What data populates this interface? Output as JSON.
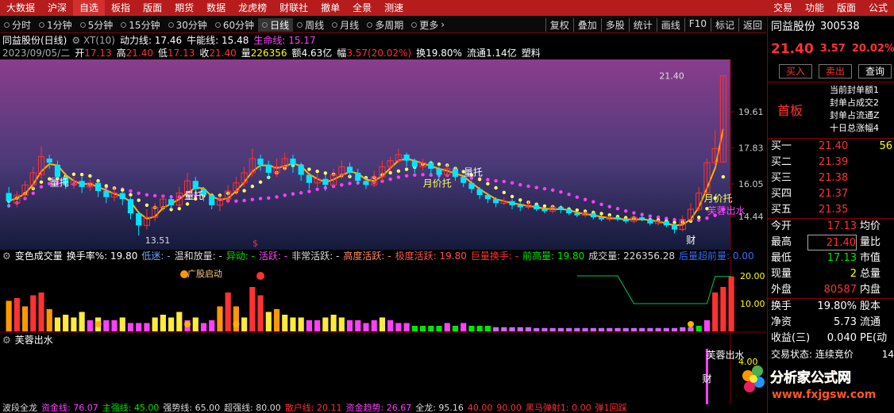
{
  "top_menu": [
    "大数据",
    "沪深",
    "自选",
    "板指",
    "版面",
    "期货",
    "数据",
    "龙虎榜",
    "财联社",
    "撤单",
    "全景",
    "测速"
  ],
  "top_menu_active": "自选",
  "top_menu_right": [
    "交易",
    "功能",
    "版面",
    "公式"
  ],
  "toolbar": [
    "分时",
    "1分钟",
    "5分钟",
    "15分钟",
    "30分钟",
    "60分钟",
    "日线",
    "周线",
    "月线",
    "多周期",
    "更多"
  ],
  "toolbar_active": "日线",
  "toolbar_more_arrow": "›",
  "toolbar_right": [
    "复权",
    "叠加",
    "多股",
    "统计",
    "画线",
    "F10",
    "标记",
    "返回"
  ],
  "info": {
    "name": "同益股份(日线)",
    "xt": "XT(10)",
    "dongli": "动力线: 17.46",
    "niuneng": "牛能线: 15.48",
    "shengming": "生命线: 15.17",
    "date": "2023/09/05/二",
    "open_label": "开",
    "open": "17.13",
    "high_label": "高",
    "high": "21.40",
    "low_label": "低",
    "low": "17.13",
    "close_label": "收",
    "close": "21.40",
    "vol_label": "量",
    "vol": "226356",
    "amt_label": "额",
    "amt": "4.63亿",
    "chg_label": "幅",
    "chg": "3.57(20.02%)",
    "turn_label": "换",
    "turn": "19.80%",
    "float_label": "流通",
    "float": "1.14亿",
    "sector": "塑料"
  },
  "main_axis": [
    "19.61",
    "17.83",
    "16.05",
    "14.44"
  ],
  "main_labels": {
    "hi_marker": "21.40",
    "lo_marker": "13.51",
    "s_marker": "$",
    "liang1": "量托",
    "liang2": "量托",
    "yue1": "月价托",
    "yue2": "月价托",
    "liang3": "量托",
    "fr": "芙蓉出水",
    "cai": "财",
    "liang4": "量托"
  },
  "vol": {
    "title": "变色成交量",
    "turn": "换手率%: 19.80",
    "items": [
      {
        "t": "低迷: -",
        "c": "#6fa8ff"
      },
      {
        "t": "温和放量: -",
        "c": "#ddd"
      },
      {
        "t": "异动: -",
        "c": "#00e600"
      },
      {
        "t": "活跃: -",
        "c": "#ff40ff"
      },
      {
        "t": "非常活跃: -",
        "c": "#ddd"
      },
      {
        "t": "高度活跃: -",
        "c": "#ff8a65"
      },
      {
        "t": "极度活跃: 19.80",
        "c": "#ff5252"
      },
      {
        "t": "巨量换手: -",
        "c": "#ff3232"
      },
      {
        "t": "前高量: 19.80",
        "c": "#00e600"
      },
      {
        "t": "成交量: 226356.28",
        "c": "#ddd"
      },
      {
        "t": "后量超前量: 0.00",
        "c": "#3b6cff"
      }
    ],
    "axis": [
      "20.00",
      "10.00"
    ],
    "start_label": "广股启动"
  },
  "fr": {
    "title": "芙蓉出水",
    "label": "芙蓉出水",
    "cai": "财",
    "axis": "4.00"
  },
  "bottom": [
    {
      "t": "波段全龙",
      "c": "#ddd"
    },
    {
      "t": "资金线: 76.07",
      "c": "#ff40ff"
    },
    {
      "t": "主强线: 45.00",
      "c": "#00e600"
    },
    {
      "t": "强势线: 65.00",
      "c": "#ddd"
    },
    {
      "t": "超强线: 80.00",
      "c": "#ddd"
    },
    {
      "t": "散户线: 20.11",
      "c": "#ff3232"
    },
    {
      "t": "资金趋势: 26.67",
      "c": "#ff40ff"
    },
    {
      "t": "全龙: 95.16",
      "c": "#ddd"
    },
    {
      "t": "40.00",
      "c": "#ff3232"
    },
    {
      "t": "90.00",
      "c": "#ff3232"
    },
    {
      "t": "黑马弹射1: 0.00",
      "c": "#ff3232"
    },
    {
      "t": "弹1回踩",
      "c": "#ff3232"
    }
  ],
  "stock": {
    "name": "同益股份",
    "code": "300538",
    "price": "21.40",
    "chg": "3.57",
    "pct": "20.02%"
  },
  "buttons": [
    "买入",
    "卖出",
    "查询"
  ],
  "limit": {
    "big": "首板",
    "items": [
      {
        "l": "当前封单额",
        "v": "1"
      },
      {
        "l": "封单占成交",
        "v": "2"
      },
      {
        "l": "封单占流通",
        "v": "Z"
      },
      {
        "l": "十日总涨幅",
        "v": "4"
      }
    ]
  },
  "book": [
    {
      "l": "买一",
      "p": "21.40",
      "v": "56"
    },
    {
      "l": "买二",
      "p": "21.39",
      "v": ""
    },
    {
      "l": "买三",
      "p": "21.38",
      "v": ""
    },
    {
      "l": "买四",
      "p": "21.37",
      "v": ""
    },
    {
      "l": "买五",
      "p": "21.35",
      "v": ""
    }
  ],
  "stats": [
    {
      "l": "今开",
      "v": "17.13",
      "vc": "#ff3232",
      "l2": "均价"
    },
    {
      "l": "最高",
      "v": "21.40",
      "vc": "#ff3232",
      "l2": "量比",
      "box": true
    },
    {
      "l": "最低",
      "v": "17.13",
      "vc": "#00e600",
      "l2": "市值"
    },
    {
      "l": "现量",
      "v": "2",
      "vc": "#ffff00",
      "l2": "总量"
    },
    {
      "l": "外盘",
      "v": "80587",
      "vc": "#ff3232",
      "l2": "内盘"
    }
  ],
  "stats2": [
    {
      "l": "换手",
      "v": "19.80%",
      "l2": "股本"
    },
    {
      "l": "净资",
      "v": "5.73",
      "l2": "流通"
    },
    {
      "l": "收益(三)",
      "v": "0.040",
      "l2": "PE(动"
    }
  ],
  "trade_status": "交易状态: 连续竞价",
  "trade_status_v": "14",
  "watermark": {
    "name": "分析家公式网",
    "url": "www.fxjgsw.com"
  },
  "colors": {
    "up": "#ff3232",
    "down": "#00e5ff",
    "yellow_line": "#ffb300",
    "magenta_dots": "#ff40ff"
  },
  "chart_data": {
    "type": "candlestick",
    "ylim": [
      12.8,
      22.2
    ],
    "candles": [
      [
        15.6,
        15.2,
        15.9,
        14.9
      ],
      [
        15.1,
        15.5,
        15.7,
        14.9
      ],
      [
        15.5,
        16.0,
        16.2,
        15.3
      ],
      [
        16.0,
        16.6,
        16.9,
        15.8
      ],
      [
        16.5,
        17.4,
        17.9,
        16.3
      ],
      [
        17.3,
        17.1,
        17.5,
        16.8
      ],
      [
        17.0,
        16.4,
        17.2,
        16.2
      ],
      [
        16.4,
        16.0,
        16.6,
        15.8
      ],
      [
        16.0,
        16.2,
        16.4,
        15.8
      ],
      [
        16.2,
        15.9,
        16.4,
        15.6
      ],
      [
        15.9,
        16.1,
        16.3,
        15.7
      ],
      [
        16.1,
        15.7,
        16.2,
        15.4
      ],
      [
        15.7,
        15.4,
        15.8,
        15.1
      ],
      [
        15.4,
        15.6,
        15.9,
        15.2
      ],
      [
        15.6,
        15.3,
        15.7,
        15.0
      ],
      [
        15.3,
        14.6,
        15.4,
        14.3
      ],
      [
        14.6,
        14.0,
        14.7,
        13.5
      ],
      [
        14.0,
        14.4,
        14.8,
        13.8
      ],
      [
        14.4,
        14.9,
        15.1,
        14.2
      ],
      [
        14.9,
        15.3,
        15.5,
        14.7
      ],
      [
        15.3,
        15.0,
        15.5,
        14.8
      ],
      [
        15.0,
        15.6,
        15.9,
        14.9
      ],
      [
        15.6,
        16.2,
        16.6,
        15.4
      ],
      [
        16.2,
        15.8,
        16.4,
        15.6
      ],
      [
        15.8,
        15.5,
        15.9,
        15.2
      ],
      [
        15.5,
        15.0,
        15.6,
        14.8
      ],
      [
        15.0,
        15.3,
        15.5,
        14.7
      ],
      [
        15.3,
        15.7,
        16.0,
        15.1
      ],
      [
        15.7,
        16.1,
        16.4,
        15.5
      ],
      [
        16.1,
        16.6,
        16.9,
        15.9
      ],
      [
        16.6,
        17.3,
        17.8,
        16.4
      ],
      [
        17.3,
        17.0,
        17.5,
        16.7
      ],
      [
        17.0,
        16.6,
        17.2,
        16.3
      ],
      [
        16.6,
        16.9,
        17.3,
        16.4
      ],
      [
        16.9,
        17.3,
        17.6,
        16.7
      ],
      [
        17.3,
        17.0,
        17.5,
        16.6
      ],
      [
        17.0,
        16.5,
        17.1,
        16.2
      ],
      [
        16.5,
        16.1,
        16.6,
        15.8
      ],
      [
        16.1,
        16.3,
        16.6,
        15.9
      ],
      [
        16.3,
        16.0,
        16.5,
        15.7
      ],
      [
        16.0,
        16.5,
        16.8,
        15.9
      ],
      [
        16.5,
        16.9,
        17.2,
        16.3
      ],
      [
        16.9,
        16.6,
        17.1,
        16.4
      ],
      [
        16.6,
        16.2,
        16.8,
        16.0
      ],
      [
        16.2,
        16.0,
        16.4,
        15.8
      ],
      [
        16.0,
        16.4,
        16.7,
        15.9
      ],
      [
        16.4,
        16.9,
        17.2,
        16.2
      ],
      [
        16.9,
        17.2,
        17.4,
        16.7
      ],
      [
        17.2,
        17.5,
        17.8,
        17.1
      ],
      [
        17.5,
        17.2,
        17.6,
        16.9
      ],
      [
        17.2,
        16.9,
        17.3,
        16.6
      ],
      [
        16.9,
        17.1,
        17.3,
        16.7
      ],
      [
        17.1,
        16.8,
        17.2,
        16.5
      ],
      [
        16.8,
        16.5,
        16.9,
        16.3
      ],
      [
        16.5,
        16.8,
        17.0,
        16.4
      ],
      [
        16.8,
        16.4,
        16.9,
        16.2
      ],
      [
        16.4,
        16.1,
        16.5,
        15.9
      ],
      [
        16.1,
        15.8,
        16.2,
        15.6
      ],
      [
        15.8,
        15.5,
        15.9,
        15.3
      ],
      [
        15.5,
        15.3,
        15.6,
        15.1
      ],
      [
        15.3,
        15.1,
        15.4,
        14.9
      ],
      [
        15.1,
        15.2,
        15.4,
        15.0
      ],
      [
        15.2,
        15.0,
        15.3,
        14.8
      ],
      [
        15.0,
        14.9,
        15.2,
        14.7
      ],
      [
        14.9,
        15.0,
        15.2,
        14.8
      ],
      [
        15.0,
        14.8,
        15.1,
        14.7
      ],
      [
        14.8,
        14.7,
        14.9,
        14.6
      ],
      [
        14.7,
        14.9,
        15.0,
        14.6
      ],
      [
        14.9,
        14.8,
        15.0,
        14.6
      ],
      [
        14.8,
        14.6,
        14.9,
        14.5
      ],
      [
        14.6,
        14.5,
        14.7,
        14.4
      ],
      [
        14.5,
        14.6,
        14.7,
        14.4
      ],
      [
        14.6,
        14.4,
        14.7,
        14.3
      ],
      [
        14.4,
        14.3,
        14.5,
        14.2
      ],
      [
        14.3,
        14.4,
        14.5,
        14.2
      ],
      [
        14.4,
        14.3,
        14.5,
        14.2
      ],
      [
        14.3,
        14.2,
        14.4,
        14.1
      ],
      [
        14.2,
        14.4,
        14.5,
        14.1
      ],
      [
        14.4,
        14.3,
        14.5,
        14.2
      ],
      [
        14.3,
        14.1,
        14.4,
        14.0
      ],
      [
        14.1,
        14.2,
        14.3,
        14.0
      ],
      [
        14.2,
        14.0,
        14.3,
        13.9
      ],
      [
        14.0,
        13.8,
        14.1,
        13.6
      ],
      [
        13.8,
        14.3,
        14.5,
        13.7
      ],
      [
        14.3,
        14.8,
        15.1,
        14.2
      ],
      [
        14.8,
        15.6,
        15.9,
        14.7
      ],
      [
        15.6,
        17.1,
        17.3,
        15.5
      ],
      [
        17.1,
        17.8,
        18.7,
        16.9
      ],
      [
        17.13,
        21.4,
        21.4,
        17.13
      ]
    ],
    "volumes": [
      11,
      12,
      9,
      13,
      14,
      8,
      5,
      6,
      5,
      7,
      4,
      5,
      4,
      4,
      5,
      3,
      3,
      3,
      5,
      6,
      5,
      7,
      4,
      5,
      3,
      4,
      9,
      14,
      9,
      5,
      16,
      13,
      7,
      8,
      6,
      5,
      5,
      4,
      4,
      5,
      6,
      5,
      4,
      4,
      3,
      4,
      5,
      4,
      3,
      3,
      2,
      2,
      2,
      2,
      3,
      2,
      3,
      2,
      2,
      2,
      1.5,
      1.5,
      1.5,
      1.5,
      1.5,
      1.2,
      1.2,
      1.2,
      1.2,
      1.2,
      1.2,
      1.2,
      1.2,
      1.2,
      1.2,
      1.2,
      1.2,
      1.2,
      1.2,
      1.2,
      1.2,
      1.2,
      1.2,
      1.5,
      1.5,
      2,
      4,
      14,
      16,
      19.8
    ],
    "fr_signal_index": 86
  }
}
